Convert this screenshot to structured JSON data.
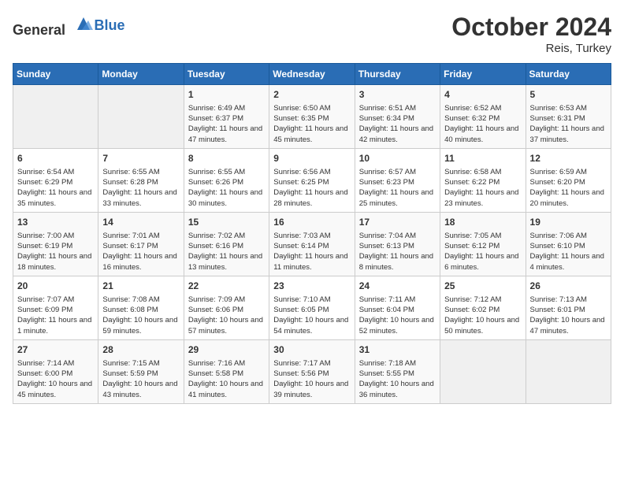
{
  "logo": {
    "general": "General",
    "blue": "Blue"
  },
  "header": {
    "month": "October 2024",
    "location": "Reis, Turkey"
  },
  "days_of_week": [
    "Sunday",
    "Monday",
    "Tuesday",
    "Wednesday",
    "Thursday",
    "Friday",
    "Saturday"
  ],
  "weeks": [
    [
      {
        "day": "",
        "info": ""
      },
      {
        "day": "",
        "info": ""
      },
      {
        "day": "1",
        "info": "Sunrise: 6:49 AM\nSunset: 6:37 PM\nDaylight: 11 hours and 47 minutes."
      },
      {
        "day": "2",
        "info": "Sunrise: 6:50 AM\nSunset: 6:35 PM\nDaylight: 11 hours and 45 minutes."
      },
      {
        "day": "3",
        "info": "Sunrise: 6:51 AM\nSunset: 6:34 PM\nDaylight: 11 hours and 42 minutes."
      },
      {
        "day": "4",
        "info": "Sunrise: 6:52 AM\nSunset: 6:32 PM\nDaylight: 11 hours and 40 minutes."
      },
      {
        "day": "5",
        "info": "Sunrise: 6:53 AM\nSunset: 6:31 PM\nDaylight: 11 hours and 37 minutes."
      }
    ],
    [
      {
        "day": "6",
        "info": "Sunrise: 6:54 AM\nSunset: 6:29 PM\nDaylight: 11 hours and 35 minutes."
      },
      {
        "day": "7",
        "info": "Sunrise: 6:55 AM\nSunset: 6:28 PM\nDaylight: 11 hours and 33 minutes."
      },
      {
        "day": "8",
        "info": "Sunrise: 6:55 AM\nSunset: 6:26 PM\nDaylight: 11 hours and 30 minutes."
      },
      {
        "day": "9",
        "info": "Sunrise: 6:56 AM\nSunset: 6:25 PM\nDaylight: 11 hours and 28 minutes."
      },
      {
        "day": "10",
        "info": "Sunrise: 6:57 AM\nSunset: 6:23 PM\nDaylight: 11 hours and 25 minutes."
      },
      {
        "day": "11",
        "info": "Sunrise: 6:58 AM\nSunset: 6:22 PM\nDaylight: 11 hours and 23 minutes."
      },
      {
        "day": "12",
        "info": "Sunrise: 6:59 AM\nSunset: 6:20 PM\nDaylight: 11 hours and 20 minutes."
      }
    ],
    [
      {
        "day": "13",
        "info": "Sunrise: 7:00 AM\nSunset: 6:19 PM\nDaylight: 11 hours and 18 minutes."
      },
      {
        "day": "14",
        "info": "Sunrise: 7:01 AM\nSunset: 6:17 PM\nDaylight: 11 hours and 16 minutes."
      },
      {
        "day": "15",
        "info": "Sunrise: 7:02 AM\nSunset: 6:16 PM\nDaylight: 11 hours and 13 minutes."
      },
      {
        "day": "16",
        "info": "Sunrise: 7:03 AM\nSunset: 6:14 PM\nDaylight: 11 hours and 11 minutes."
      },
      {
        "day": "17",
        "info": "Sunrise: 7:04 AM\nSunset: 6:13 PM\nDaylight: 11 hours and 8 minutes."
      },
      {
        "day": "18",
        "info": "Sunrise: 7:05 AM\nSunset: 6:12 PM\nDaylight: 11 hours and 6 minutes."
      },
      {
        "day": "19",
        "info": "Sunrise: 7:06 AM\nSunset: 6:10 PM\nDaylight: 11 hours and 4 minutes."
      }
    ],
    [
      {
        "day": "20",
        "info": "Sunrise: 7:07 AM\nSunset: 6:09 PM\nDaylight: 11 hours and 1 minute."
      },
      {
        "day": "21",
        "info": "Sunrise: 7:08 AM\nSunset: 6:08 PM\nDaylight: 10 hours and 59 minutes."
      },
      {
        "day": "22",
        "info": "Sunrise: 7:09 AM\nSunset: 6:06 PM\nDaylight: 10 hours and 57 minutes."
      },
      {
        "day": "23",
        "info": "Sunrise: 7:10 AM\nSunset: 6:05 PM\nDaylight: 10 hours and 54 minutes."
      },
      {
        "day": "24",
        "info": "Sunrise: 7:11 AM\nSunset: 6:04 PM\nDaylight: 10 hours and 52 minutes."
      },
      {
        "day": "25",
        "info": "Sunrise: 7:12 AM\nSunset: 6:02 PM\nDaylight: 10 hours and 50 minutes."
      },
      {
        "day": "26",
        "info": "Sunrise: 7:13 AM\nSunset: 6:01 PM\nDaylight: 10 hours and 47 minutes."
      }
    ],
    [
      {
        "day": "27",
        "info": "Sunrise: 7:14 AM\nSunset: 6:00 PM\nDaylight: 10 hours and 45 minutes."
      },
      {
        "day": "28",
        "info": "Sunrise: 7:15 AM\nSunset: 5:59 PM\nDaylight: 10 hours and 43 minutes."
      },
      {
        "day": "29",
        "info": "Sunrise: 7:16 AM\nSunset: 5:58 PM\nDaylight: 10 hours and 41 minutes."
      },
      {
        "day": "30",
        "info": "Sunrise: 7:17 AM\nSunset: 5:56 PM\nDaylight: 10 hours and 39 minutes."
      },
      {
        "day": "31",
        "info": "Sunrise: 7:18 AM\nSunset: 5:55 PM\nDaylight: 10 hours and 36 minutes."
      },
      {
        "day": "",
        "info": ""
      },
      {
        "day": "",
        "info": ""
      }
    ]
  ]
}
